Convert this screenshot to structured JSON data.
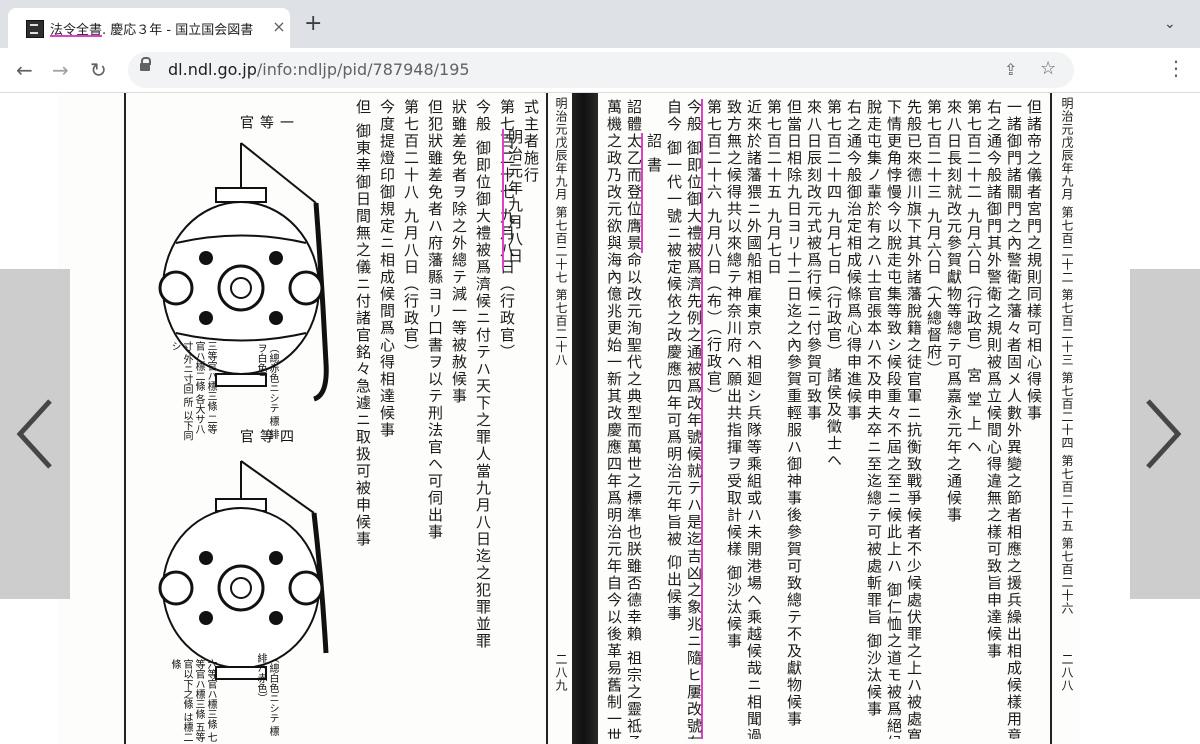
{
  "tab": {
    "title_hl": "法令全書",
    "title_rest": ". 慶応３年 - 国立国会図書",
    "close": "×"
  },
  "newtab": "+",
  "tabmenu": "⌄",
  "nav": {
    "back": "←",
    "forward": "→",
    "reload": "↻"
  },
  "omnibox": {
    "host": "dl.ndl.go.jp",
    "path": "/info:ndljp/pid/787948/195",
    "share": "⇪",
    "star": "☆"
  },
  "menu": "⋮",
  "viewer": {
    "left_page": {
      "lantern1_label": "一 等 官",
      "lantern1_note": "（總赤色ニシテ 標 緋ヲ白色）",
      "lantern1_note2": "三等官ハ標三條 二等官ハ標二條 各大サ八寸 外ニ寸回 所 以下同シ",
      "lantern2_label": "四 等 官",
      "lantern2_note": "（總白色ニシテ 標 緋ハ赤色）",
      "lantern2_note2": "六等官ハ標三條 七等官ハ標三條 五等官以下之條 は標二條",
      "page_number": "二八九",
      "running_head": "明治元戊辰年九月 第七百二十七 第七百二十八",
      "columns": [
        "但 御東幸御日間無之儀ニ付諸官銘々急遽ニ取扱可被申候事",
        "今度提燈印御規定ニ相成候間爲心得相達候事",
        "第七百二十八  九月八日（行政官）",
        "但犯狀雖差免者ハ府藩縣ヨリ口書ヲ以テ刑法官ヘ可伺出事",
        "狀雖差免者ヲ除之外總テ減一等被赦候事",
        "今般 御即位御大禮被爲濟候ニ付テハ天下之罪人當九月八日迄之犯罪並罪",
        "第七百二十七  九月八日（行政官）",
        "式主者施行"
      ],
      "mark_column": "明治元年九月八日"
    },
    "right_page": {
      "running_head": "明治元戊辰年九月 第七百二十二 第七百二十三 第七百二十四 第七百二十五 第七百二十六",
      "page_number": "二八八",
      "columns": [
        "但諸帝之儀者宮門之規則同樣可相心得候事",
        "一諸御門諸關門之內警衛之藩々者固メ人數外異變之節者相應之援兵繰出相成候樣用意可致旨事",
        "右之通今般諸御門其外警衛之規則被爲立候間心得違無之樣可致旨申達候事",
        "第七百二十二  九月六日（行政官）  宮 堂 上 ヘ",
        "來八日長刻就改元參賀獻物等總テ可爲嘉永元年之通候事",
        "第七百二十三  九月六日（大總督府）",
        "先般已來德川旗下其外諸藩脫籍之徒官軍ニ抗衡致戰爭候者不少候處伏罪之上ハ被處寬典候然ル處",
        "下情更角悖慢今以脫走屯集等致シ候段重々不屆之至ニ候此上ハ 御仁恤之道モ被爲絕候ニ付向後",
        "脫走屯集ノ輩於有之ハ士官張本ハ不及申夫卒ニ至迄總テ可被處斬罪旨  御沙汰候事",
        "右之通今般御治定相成候條爲心得申進候事",
        "第七百二十四  九月七日（行政官）  諸侯及徵士ヘ",
        "來八日辰刻改元式被爲行候ニ付參賀可致事",
        "但當日相除九日ヨリ十二日迄之內參賀重輕服ハ御神事後參賀可致總テ不及獻物候事",
        "第七百二十五  九月七日",
        "近來於諸藩猥ニ外國船相雇東京ヘ相廻シ兵隊等乘組或ハ未開港場ヘ乘越候哉ニ相聞過去候儀ハ",
        "致方無之候得共以來總テ神奈川府ヘ願出共指揮ヲ受取計候樣  御沙汰候事",
        "第七百二十六  九月八日（布）（行政官）",
        "今般 御即位御大禮被爲濟先例之通被爲改年號候就テハ是迄吉凶之象兆ニ隨ヒ屢改號有之候得共",
        "自今 御一代一號ニ被定候依之改慶應四年可爲明治元年旨被  仰出候事",
        "詔 書",
        "詔體太乙而登位膺景命以改元洵聖代之典型而萬世之標準也朕雖否德幸賴  祖宗之靈祗承鴻緒躬親",
        "萬機之政乃改元欲與海內億兆更始一新其改慶應四年爲明治元年自今以後革易舊制一世一元以爲永"
      ]
    }
  }
}
